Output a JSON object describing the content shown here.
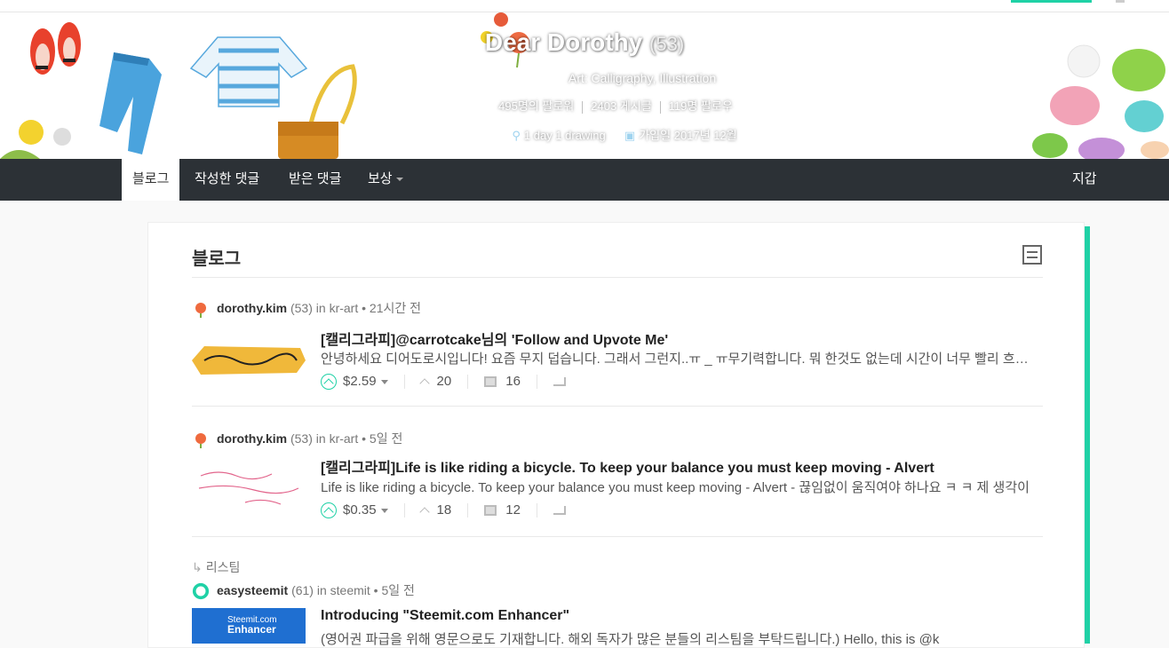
{
  "profile": {
    "name": "Dear Dorothy",
    "reputation": "(53)",
    "about": "Art: Calligraphy, Illustration",
    "followers": "495명의 팔로워",
    "posts": "2403 게시글",
    "following": "119명 팔로우",
    "location": "1 day 1 drawing",
    "joined": "가입일 2017년 12월"
  },
  "nav": {
    "tabs": [
      "블로그",
      "작성한 댓글",
      "받은 댓글",
      "보상"
    ],
    "wallet": "지갑"
  },
  "blog": {
    "heading": "블로그",
    "posts": [
      {
        "author": "dorothy.kim",
        "rep": "(53)",
        "in": "in",
        "category": "kr-art",
        "time": "• 21시간 전",
        "title": "[캘리그라피]@carrotcake님의 'Follow and Upvote Me'",
        "body": "안녕하세요 디어도로시입니다! 요즘 무지 덥습니다. 그래서 그런지..ㅠ _ ㅠ무기력합니다. 뭐 한것도 없는데 시간이 너무 빨리 흐릅니다.",
        "payout": "$2.59",
        "votes": "20",
        "comments": "16"
      },
      {
        "author": "dorothy.kim",
        "rep": "(53)",
        "in": "in",
        "category": "kr-art",
        "time": "• 5일 전",
        "title": "[캘리그라피]Life is like riding a bicycle. To keep your balance you must keep moving - Alvert",
        "body": "Life is like riding a bicycle. To keep your balance you must keep moving - Alvert - 끊임없이 움직여야 하나요 ㅋ ㅋ 제 생각이",
        "payout": "$0.35",
        "votes": "18",
        "comments": "12"
      }
    ],
    "resteem": {
      "label": "리스팀",
      "author": "easysteemit",
      "rep": "(61)",
      "in": "in",
      "category": "steemit",
      "time": "• 5일 전",
      "title": "Introducing \"Steemit.com Enhancer\"",
      "body": "(영어권 파급을 위해 영문으로도 기재합니다. 해외 독자가 많은 분들의 리스팀을 부탁드립니다.) Hello, this is @k",
      "thumb_top": "Steemit.com",
      "thumb_bottom": "Enhancer"
    }
  },
  "colors": {
    "accent": "#1fd1a6",
    "nav_bg": "#2c3136"
  }
}
